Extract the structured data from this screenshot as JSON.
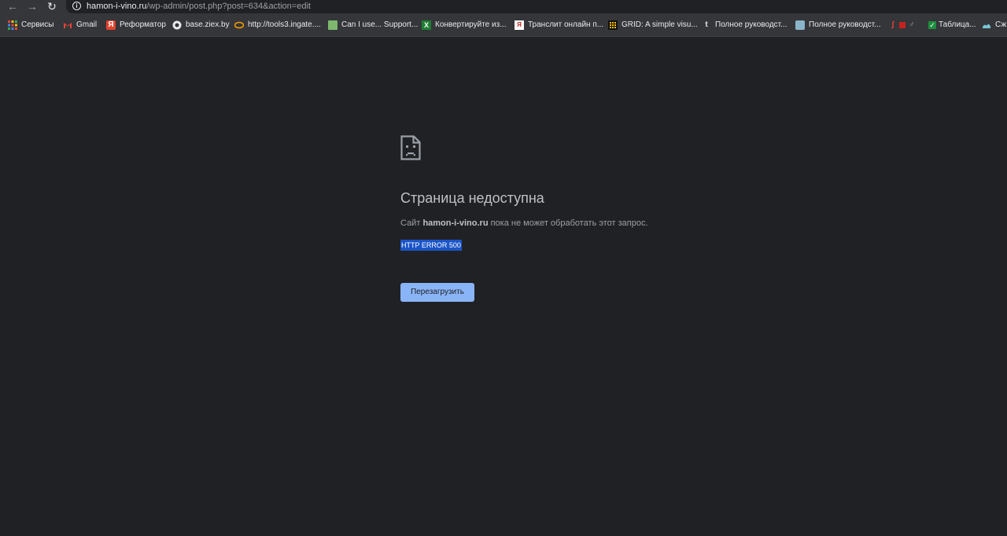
{
  "browser": {
    "nav": {
      "back_icon": "←",
      "forward_icon": "→",
      "reload_icon": "↻"
    },
    "address_bar": {
      "host": "hamon-i-vino.ru",
      "path": "/wp-admin/post.php?post=634&action=edit",
      "info_icon": "i"
    }
  },
  "bookmarks": [
    {
      "label": "Сервисы",
      "icon": "apps-grid-icon"
    },
    {
      "label": "Gmail",
      "icon": "gmail-icon"
    },
    {
      "label": "Реформатор",
      "icon": "reformator-icon"
    },
    {
      "label": "base.ziex.by",
      "icon": "globe-icon"
    },
    {
      "label": "http://tools3.ingate....",
      "icon": "ingate-icon"
    },
    {
      "label": "Can I use... Support...",
      "icon": "caniuse-icon"
    },
    {
      "label": "Конвертируйте из...",
      "icon": "converter-icon"
    },
    {
      "label": "Транслит онлайн п...",
      "icon": "translit-icon"
    },
    {
      "label": "GRID: A simple visu...",
      "icon": "grid-icon"
    },
    {
      "label": "Полное руководст...",
      "icon": "tumblr-icon"
    },
    {
      "label": "Полное руководст...",
      "icon": "guide-icon"
    },
    {
      "label": "",
      "icon": "red-extension-icon"
    },
    {
      "label": "Таблица...",
      "icon": "checkbox-icon"
    },
    {
      "label": "Сж",
      "icon": "compress-icon"
    }
  ],
  "error_page": {
    "title": "Страница недоступна",
    "desc_prefix": "Сайт ",
    "desc_host": "hamon-i-vino.ru",
    "desc_suffix": " пока не может обработать этот запрос.",
    "error_code": "HTTP ERROR 500",
    "reload_label": "Перезагрузить"
  },
  "colors": {
    "page_background": "#202124",
    "toolbar": "#35363a",
    "button": "#8ab4f8",
    "selection": "#1a55c8"
  }
}
